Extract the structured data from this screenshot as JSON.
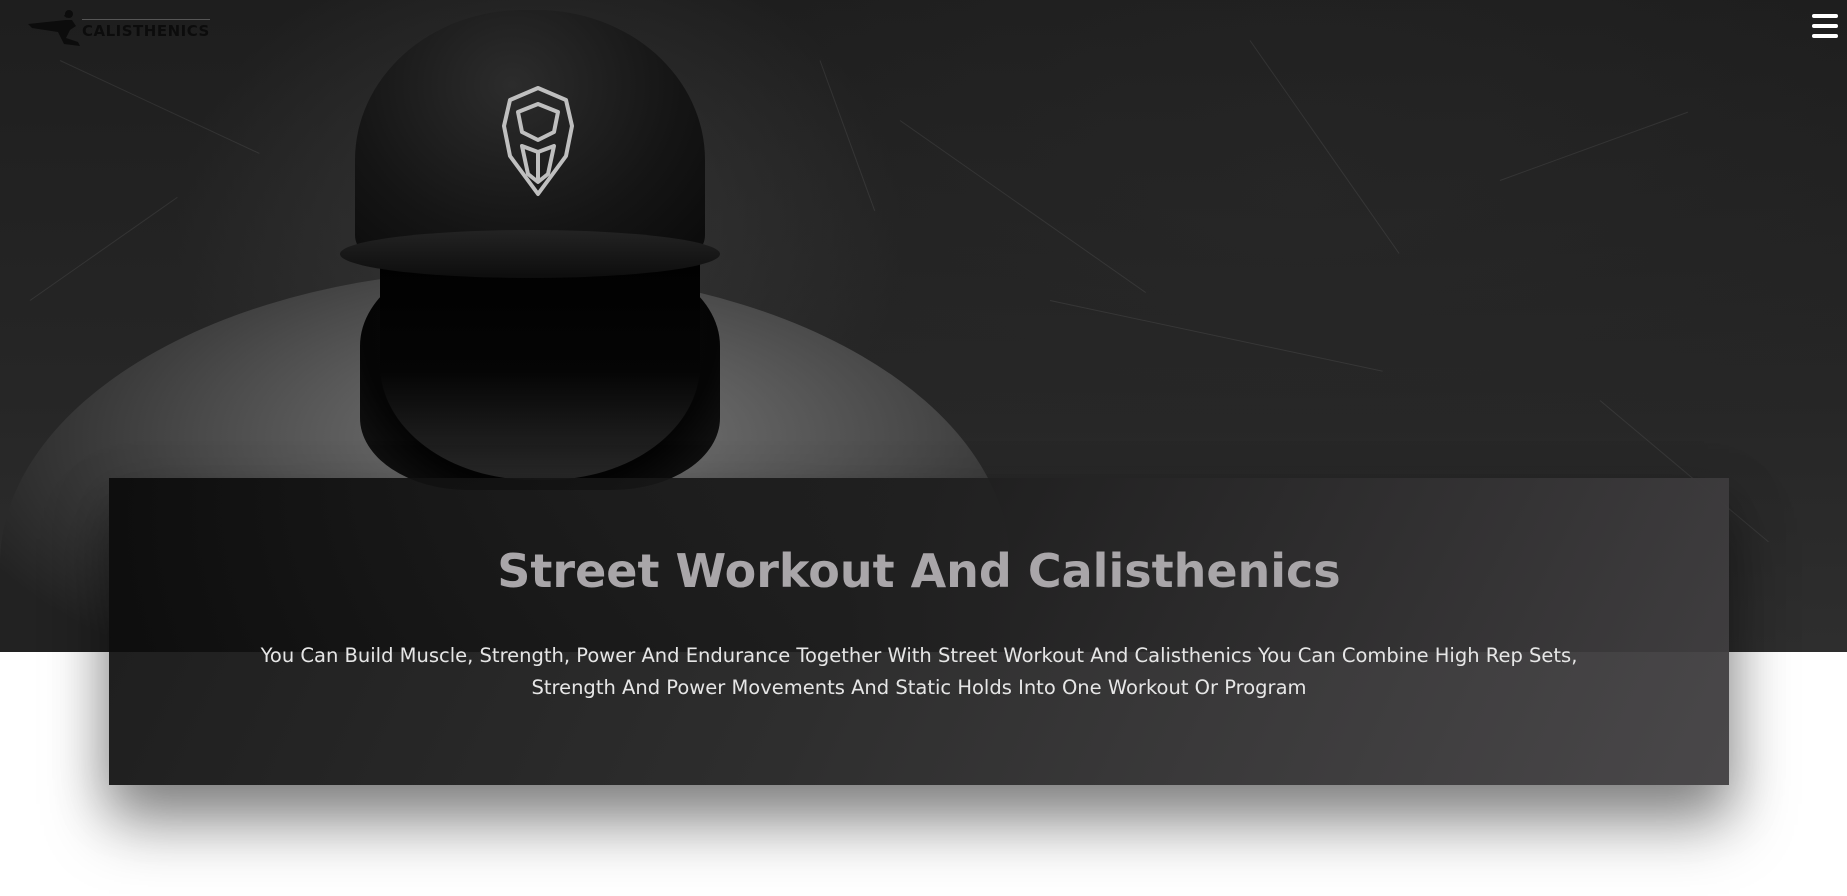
{
  "header": {
    "logo_text": "CALISTHENICS",
    "logo_icon": "athlete-silhouette-icon",
    "menu_icon": "hamburger-menu-icon"
  },
  "hero": {
    "title": "Street Workout And Calisthenics",
    "description": "You Can Build Muscle, Strength, Power And Endurance Together With Street Workout And Calisthenics You Can Combine High Rep Sets, Strength And Power Movements And Static Holds Into One Workout Or Program"
  },
  "colors": {
    "title": "#a9a6a9",
    "description": "#e6e6e6",
    "menu_icon": "#ffffff",
    "page_background": "#ffffff"
  }
}
